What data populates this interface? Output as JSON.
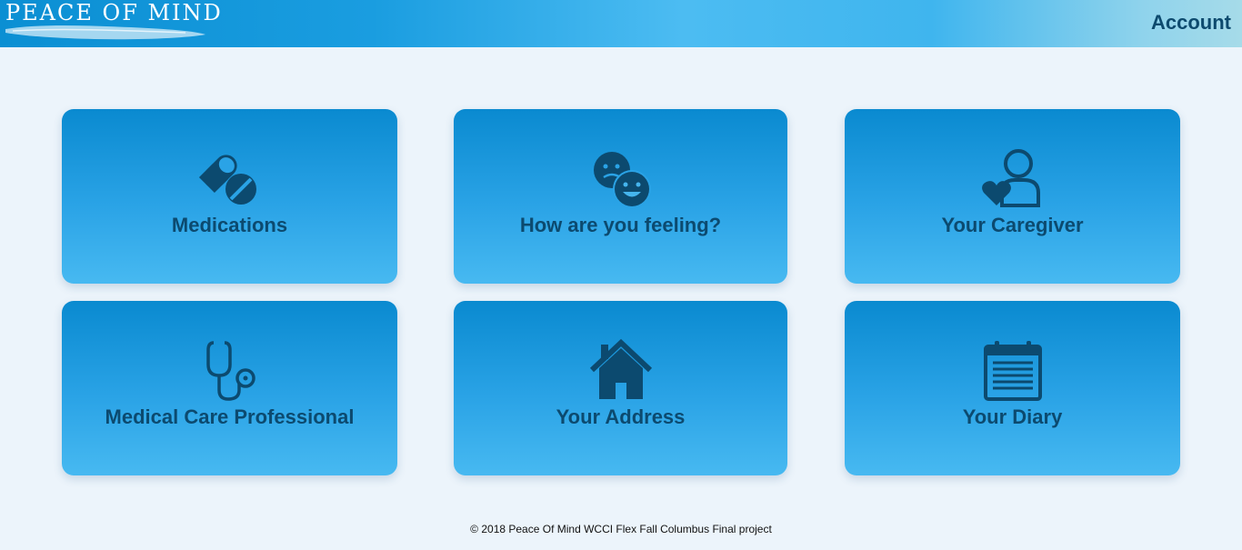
{
  "header": {
    "logo_text": "PEACE OF MIND",
    "account_label": "Account"
  },
  "tiles": [
    {
      "label": "Medications",
      "icon": "pills-icon"
    },
    {
      "label": "How are you feeling?",
      "icon": "mood-faces-icon"
    },
    {
      "label": "Your Caregiver",
      "icon": "caregiver-heart-icon"
    },
    {
      "label": "Medical Care Professional",
      "icon": "stethoscope-icon"
    },
    {
      "label": "Your Address",
      "icon": "home-icon"
    },
    {
      "label": "Your Diary",
      "icon": "calendar-notepad-icon"
    }
  ],
  "footer": {
    "text": "© 2018 Peace Of Mind WCCI Flex Fall Columbus Final project"
  },
  "colors": {
    "header_start": "#0b8fd3",
    "header_end": "#a6dbe9",
    "tile_top": "#0a8ad0",
    "tile_bottom": "#47b9f1",
    "tile_text": "#0c4a6f",
    "page_bg": "#ecf4fb"
  }
}
